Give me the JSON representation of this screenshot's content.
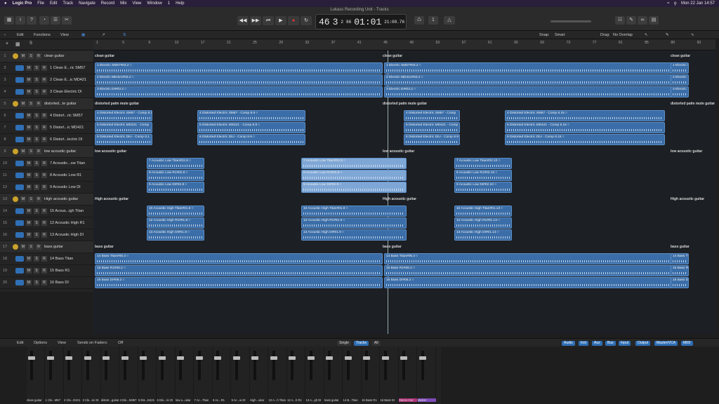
{
  "menu": {
    "apple": "",
    "app": "Logic Pro",
    "items": [
      "File",
      "Edit",
      "Track",
      "Navigate",
      "Record",
      "Mix",
      "View",
      "Window",
      "1",
      "Help"
    ],
    "clock": "Mon 22 Jan  14:57"
  },
  "window": {
    "title": "Lukass Recording Unit - Tracks"
  },
  "lcd": {
    "bar": "46",
    "beat": "3",
    "div": "2",
    "tick": "86",
    "time": "01:01",
    "sub": "21:00.76"
  },
  "toolbar": {
    "edit": "Edit",
    "functions": "Functions",
    "view": "View",
    "snap_label": "Snap:",
    "snap": "Smart",
    "drag_label": "Drag:",
    "drag": "No Overlap"
  },
  "ruler": [
    "1",
    "5",
    "9",
    "13",
    "17",
    "21",
    "25",
    "29",
    "33",
    "37",
    "41",
    "45",
    "49",
    "53",
    "57",
    "61",
    "65",
    "69",
    "73",
    "77",
    "81",
    "85",
    "89",
    "93"
  ],
  "tracks": [
    {
      "n": "1",
      "name": "clean guitar",
      "folder": true
    },
    {
      "n": "2",
      "name": "1 Clean E...ric SM57"
    },
    {
      "n": "3",
      "name": "2 Clean E...ic MD421"
    },
    {
      "n": "4",
      "name": "3 Clean Electric DI"
    },
    {
      "n": "5",
      "name": "distorted...te guitar",
      "folder": true
    },
    {
      "n": "6",
      "name": "4 Distort...ric SM57"
    },
    {
      "n": "7",
      "name": "5 Distort...ic MD421"
    },
    {
      "n": "8",
      "name": "6 Distort...lectric DI"
    },
    {
      "n": "9",
      "name": "low acoustic guitar",
      "folder": true
    },
    {
      "n": "10",
      "name": "7 Acoustic...ow Titan"
    },
    {
      "n": "11",
      "name": "8 Acoustic Low R1"
    },
    {
      "n": "12",
      "name": "9 Acoustic Low DI"
    },
    {
      "n": "13",
      "name": "High acoustic guitar",
      "folder": true
    },
    {
      "n": "14",
      "name": "15 Acous...igh Titan"
    },
    {
      "n": "15",
      "name": "12 Acoustic High R1"
    },
    {
      "n": "16",
      "name": "13 Acoustic High DI"
    },
    {
      "n": "17",
      "name": "bass guitar",
      "folder": true
    },
    {
      "n": "18",
      "name": "14 Bass Titan"
    },
    {
      "n": "19",
      "name": "15 Bass R1"
    },
    {
      "n": "20",
      "name": "16 Bass DI"
    }
  ],
  "folder_labels": [
    {
      "row": 0,
      "text": "clean guitar"
    },
    {
      "row": 4,
      "text": "distorted palm mute guitar"
    },
    {
      "row": 8,
      "text": "low acoustic guitar"
    },
    {
      "row": 12,
      "text": "High acoustic guitar"
    },
    {
      "row": 16,
      "text": "bass guitar"
    }
  ],
  "regions": [
    {
      "row": 1,
      "label": "1 Electric SM57#03.2 ○"
    },
    {
      "row": 1,
      "label": "1 Electric SM57#03.2 ○"
    },
    {
      "row": 1,
      "label": "1 Electric S"
    },
    {
      "row": 2,
      "label": "2 Electric MD421#03.2 ○"
    },
    {
      "row": 2,
      "label": "2 Electric MD421#03.2 ○"
    },
    {
      "row": 2,
      "label": "2 Electric"
    },
    {
      "row": 3,
      "label": "3 Electric DI#03.2 ○"
    },
    {
      "row": 3,
      "label": "3 Electric DI#03.2 ○"
    },
    {
      "row": 3,
      "label": "3 Electric"
    },
    {
      "row": 5,
      "label": "4 Distorted Electric SM57 - Comp 8.1"
    },
    {
      "row": 5,
      "label": "4 Distorted Electric SM57 - Comp 8.9 ○"
    },
    {
      "row": 5,
      "label": "4 Distorted Electric SM57 - Comp"
    },
    {
      "row": 5,
      "label": "4 Distorted Electric SM57 - Comp 8.15 ○"
    },
    {
      "row": 6,
      "label": "5 Distorted Electric MD421 - Comp"
    },
    {
      "row": 6,
      "label": "5 Distorted Electric MD421 - Comp 8.9 ○"
    },
    {
      "row": 6,
      "label": "5 Distorted Electric MD421 - Comp"
    },
    {
      "row": 6,
      "label": "5 Distorted Electric MD421 - Comp 8.15 ○"
    },
    {
      "row": 7,
      "label": "6 Distorted Electric DIU - Comp 8.1"
    },
    {
      "row": 7,
      "label": "6 Distorted Electric DIU - Comp 8.9 ○"
    },
    {
      "row": 7,
      "label": "6 Distorted Electric DIU - Comp 8.9"
    },
    {
      "row": 7,
      "label": "6 Distorted Electric DIU - Comp 8.15 ○"
    },
    {
      "row": 9,
      "label": "7 Acoustic Low Titan#02.8 ○"
    },
    {
      "row": 9,
      "label": "7 Acoustic Low Titan#02.9 ○"
    },
    {
      "row": 9,
      "label": "7 Acoustic Low Titan#02.10 ○"
    },
    {
      "row": 10,
      "label": "8 Acoustic Low R1#02.8 ○"
    },
    {
      "row": 10,
      "label": "8 Acoustic Low R1#02.9 ○"
    },
    {
      "row": 10,
      "label": "8 Acoustic Low R1#02.10 ○"
    },
    {
      "row": 11,
      "label": "9 Acoustic Low DI#02.8 ○"
    },
    {
      "row": 11,
      "label": "9 Acoustic Low DI#02.9 ○"
    },
    {
      "row": 11,
      "label": "9 Acoustic Low DI#02.10 ○"
    },
    {
      "row": 13,
      "label": "10 Acoustic High Titan#01.8 ○"
    },
    {
      "row": 13,
      "label": "10 Acoustic High Titan#01.9 ○"
    },
    {
      "row": 13,
      "label": "10 Acoustic High Titan#01.13 ○"
    },
    {
      "row": 14,
      "label": "12 Acoustic High R1#01.8 ○"
    },
    {
      "row": 14,
      "label": "12 Acoustic High R1#01.9 ○"
    },
    {
      "row": 14,
      "label": "12 Acoustic High R1#01.13 ○"
    },
    {
      "row": 15,
      "label": "13 Acoustic High DI#01.8 ○"
    },
    {
      "row": 15,
      "label": "13 Acoustic High DI#01.9 ○"
    },
    {
      "row": 15,
      "label": "13 Acoustic High DI#01.13 ○"
    },
    {
      "row": 17,
      "label": "14 Bass Titan#06.2 ○"
    },
    {
      "row": 17,
      "label": "14 Bass Titan#06.2 ○"
    },
    {
      "row": 17,
      "label": "14 Bass T"
    },
    {
      "row": 18,
      "label": "15 Bass R1#06.2 ○"
    },
    {
      "row": 18,
      "label": "15 Bass R1#06.2 ○"
    },
    {
      "row": 18,
      "label": "15 Bass R1"
    },
    {
      "row": 19,
      "label": "16 Bass DI#06.2 ○"
    },
    {
      "row": 19,
      "label": "16 Bass DI#06.2 ○"
    },
    {
      "row": 19,
      "label": "16 Bass DI"
    }
  ],
  "mixer": {
    "edit": "Edit",
    "options": "Options",
    "view": "View",
    "sends": "Sends on Faders:",
    "sends_val": "Off",
    "tabs": [
      "Single",
      "Tracks",
      "All"
    ],
    "filters": [
      "Audio",
      "Inst",
      "Aux",
      "Bus",
      "Input",
      "Output",
      "Master/VCA",
      "MIDI"
    ],
    "strips": [
      "clean guitar",
      "1 Cle...M57",
      "2 Cle...D421",
      "3 Cle...ric DI",
      "distort...guitar",
      "4 Dis...SM57",
      "5 Dis...D421",
      "6 Dis...ric DI",
      "low a...uitar",
      "7 Ac...Titan",
      "8 Ac...R1",
      "9 Ac...w DI",
      "High...uitar",
      "10 A...h Titan",
      "12 A...h R1",
      "13 A...gh DI",
      "bass guitar",
      "14 B...Titan",
      "15 Bass R1",
      "16 Bass DI",
      "Stereo Out",
      "Master"
    ]
  }
}
